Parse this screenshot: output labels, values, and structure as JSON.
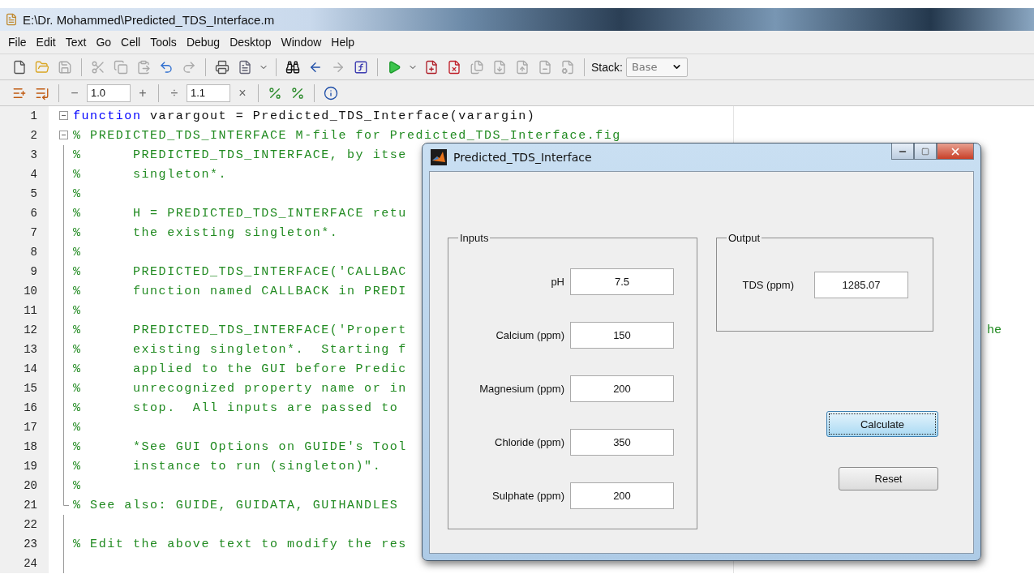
{
  "window": {
    "title": "E:\\Dr. Mohammed\\Predicted_TDS_Interface.m"
  },
  "menu": [
    "File",
    "Edit",
    "Text",
    "Go",
    "Cell",
    "Tools",
    "Debug",
    "Desktop",
    "Window",
    "Help"
  ],
  "toolbar": [
    {
      "kind": "new",
      "disabled": false
    },
    {
      "kind": "open",
      "disabled": false
    },
    {
      "kind": "save",
      "disabled": true
    },
    {
      "kind": "separator"
    },
    {
      "kind": "cut",
      "disabled": true
    },
    {
      "kind": "copy",
      "disabled": true
    },
    {
      "kind": "paste",
      "disabled": true
    },
    {
      "kind": "undo",
      "disabled": false
    },
    {
      "kind": "redo",
      "disabled": true
    },
    {
      "kind": "separator"
    },
    {
      "kind": "print",
      "disabled": false
    },
    {
      "kind": "document",
      "disabled": false
    },
    {
      "kind": "dropdown",
      "disabled": false
    },
    {
      "kind": "separator"
    },
    {
      "kind": "find",
      "disabled": false
    },
    {
      "kind": "back",
      "disabled": false
    },
    {
      "kind": "forward",
      "disabled": true
    },
    {
      "kind": "function",
      "disabled": false
    },
    {
      "kind": "separator"
    },
    {
      "kind": "run",
      "disabled": false
    },
    {
      "kind": "dropdown",
      "disabled": false
    },
    {
      "kind": "breakpoint",
      "disabled": false
    },
    {
      "kind": "clear-breakpoint",
      "disabled": false
    },
    {
      "kind": "step",
      "disabled": true
    },
    {
      "kind": "step-in",
      "disabled": true
    },
    {
      "kind": "step-out",
      "disabled": true
    },
    {
      "kind": "continue",
      "disabled": true
    },
    {
      "kind": "exit",
      "disabled": true
    },
    {
      "kind": "separator"
    }
  ],
  "stack": {
    "label": "Stack:",
    "value": "Base"
  },
  "cell_toolbar": [
    {
      "kind": "insert-before"
    },
    {
      "kind": "insert-after"
    },
    {
      "kind": "separator"
    },
    {
      "kind": "text",
      "text": "−"
    },
    {
      "kind": "field",
      "text": "1.0"
    },
    {
      "kind": "text",
      "text": "+"
    },
    {
      "kind": "separator"
    },
    {
      "kind": "text",
      "text": "÷"
    },
    {
      "kind": "field",
      "text": "1.1"
    },
    {
      "kind": "text",
      "text": "×"
    },
    {
      "kind": "separator"
    },
    {
      "kind": "comment"
    },
    {
      "kind": "uncomment"
    },
    {
      "kind": "separator"
    },
    {
      "kind": "info"
    }
  ],
  "code": [
    {
      "number": "1",
      "kind": "start",
      "segments": [
        {
          "kind": "keyword",
          "text": "function"
        },
        {
          "kind": "plain",
          "text": " varargout = Predicted_TDS_Interface(varargin)"
        }
      ]
    },
    {
      "number": "2",
      "kind": "start",
      "segments": [
        {
          "kind": "comment",
          "text": "% PREDICTED_TDS_INTERFACE M-file for Predicted_TDS_Interface.fig"
        }
      ]
    },
    {
      "number": "3",
      "kind": "inside",
      "segments": [
        {
          "kind": "comment",
          "text": "%      PREDICTED_TDS_INTERFACE, by itse"
        }
      ]
    },
    {
      "number": "4",
      "kind": "inside",
      "segments": [
        {
          "kind": "comment",
          "text": "%      singleton*."
        }
      ]
    },
    {
      "number": "5",
      "kind": "inside",
      "segments": [
        {
          "kind": "comment",
          "text": "%"
        }
      ]
    },
    {
      "number": "6",
      "kind": "inside",
      "segments": [
        {
          "kind": "comment",
          "text": "%      H = PREDICTED_TDS_INTERFACE retu"
        }
      ]
    },
    {
      "number": "7",
      "kind": "inside",
      "segments": [
        {
          "kind": "comment",
          "text": "%      the existing singleton*."
        }
      ]
    },
    {
      "number": "8",
      "kind": "inside",
      "segments": [
        {
          "kind": "comment",
          "text": "%"
        }
      ]
    },
    {
      "number": "9",
      "kind": "inside",
      "segments": [
        {
          "kind": "comment",
          "text": "%      PREDICTED_TDS_INTERFACE('CALLBAC"
        }
      ]
    },
    {
      "number": "10",
      "kind": "inside",
      "segments": [
        {
          "kind": "comment",
          "text": "%      function named CALLBACK in PREDI"
        }
      ]
    },
    {
      "number": "11",
      "kind": "inside",
      "segments": [
        {
          "kind": "comment",
          "text": "%"
        }
      ]
    },
    {
      "number": "12",
      "kind": "inside",
      "segments": [
        {
          "kind": "comment",
          "text": "%      PREDICTED_TDS_INTERFACE('Propert"
        }
      ],
      "tail": "he"
    },
    {
      "number": "13",
      "kind": "inside",
      "segments": [
        {
          "kind": "comment",
          "text": "%      existing singleton*.  Starting f"
        }
      ]
    },
    {
      "number": "14",
      "kind": "inside",
      "segments": [
        {
          "kind": "comment",
          "text": "%      applied to the GUI before Predic"
        }
      ]
    },
    {
      "number": "15",
      "kind": "inside",
      "segments": [
        {
          "kind": "comment",
          "text": "%      unrecognized property name or in"
        }
      ]
    },
    {
      "number": "16",
      "kind": "inside",
      "segments": [
        {
          "kind": "comment",
          "text": "%      stop.  All inputs are passed to"
        }
      ]
    },
    {
      "number": "17",
      "kind": "inside",
      "segments": [
        {
          "kind": "comment",
          "text": "%"
        }
      ]
    },
    {
      "number": "18",
      "kind": "inside",
      "segments": [
        {
          "kind": "comment",
          "text": "%      *See GUI Options on GUIDE's Tool"
        }
      ]
    },
    {
      "number": "19",
      "kind": "inside",
      "segments": [
        {
          "kind": "comment",
          "text": "%      instance to run (singleton)\"."
        }
      ]
    },
    {
      "number": "20",
      "kind": "inside",
      "segments": [
        {
          "kind": "comment",
          "text": "%"
        }
      ]
    },
    {
      "number": "21",
      "kind": "end",
      "segments": [
        {
          "kind": "comment",
          "text": "% See also: GUIDE, GUIDATA, GUIHANDLES"
        }
      ]
    },
    {
      "number": "22",
      "kind": "inside"
    },
    {
      "number": "23",
      "kind": "inside",
      "segments": [
        {
          "kind": "comment",
          "text": "% Edit the above text to modify the res"
        }
      ]
    },
    {
      "number": "24",
      "kind": "inside"
    }
  ],
  "dialog": {
    "title": "Predicted_TDS_Interface",
    "inputs": {
      "title": "Inputs",
      "fields": [
        {
          "label": "pH",
          "value": "7.5"
        },
        {
          "label": "Calcium (ppm)",
          "value": "150"
        },
        {
          "label": "Magnesium (ppm)",
          "value": "200"
        },
        {
          "label": "Chloride (ppm)",
          "value": "350"
        },
        {
          "label": "Sulphate (ppm)",
          "value": "200"
        }
      ]
    },
    "output": {
      "title": "Output",
      "fields": [
        {
          "label": "TDS (ppm)",
          "value": "1285.07"
        }
      ]
    },
    "buttons": [
      {
        "label": "Calculate",
        "focused": true
      },
      {
        "label": "Reset",
        "focused": false
      }
    ]
  }
}
